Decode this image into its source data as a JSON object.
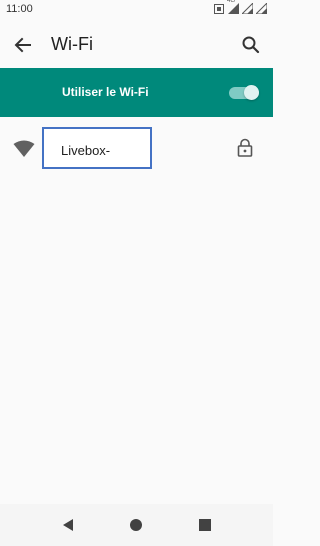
{
  "status_bar": {
    "time": "11:00",
    "icons": [
      "sim-icon",
      "signal-4g-icon",
      "signal-icon",
      "signal-icon-2"
    ],
    "signal_label": "4G"
  },
  "app_bar": {
    "title": "Wi-Fi",
    "back_icon": "arrow-back-icon",
    "search_icon": "search-icon"
  },
  "master_switch": {
    "label": "Utiliser le Wi-Fi",
    "enabled": true,
    "accent": "#00897b"
  },
  "networks": [
    {
      "name": "Livebox-",
      "secured": true,
      "signal": "wifi-icon"
    }
  ],
  "nav_bar": {
    "back_icon": "nav-back-icon",
    "home_icon": "nav-home-icon",
    "recents_icon": "nav-recents-icon"
  }
}
